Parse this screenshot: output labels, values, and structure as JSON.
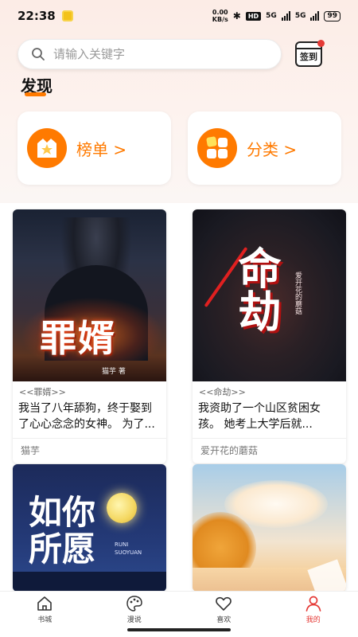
{
  "status_bar": {
    "time": "22:38",
    "net_speed_value": "0.00",
    "net_speed_unit": "KB/s",
    "hd": "HD",
    "sig1": "5G",
    "sig2": "5G",
    "battery": "99"
  },
  "header": {
    "search_placeholder": "请输入关键字",
    "checkin_label": "签到"
  },
  "discover": {
    "title": "发现",
    "cards": [
      {
        "label": "榜单 >",
        "icon": "ranking-icon"
      },
      {
        "label": "分类 >",
        "icon": "category-icon"
      }
    ]
  },
  "books": [
    {
      "cover_title": "罪婿",
      "cover_author": "猫芋 著",
      "tag": "<<罪婿>>",
      "desc": "我当了八年舔狗，终于娶到了心心念念的女神。 为了...",
      "author": "猫芋"
    },
    {
      "cover_title": "命劫",
      "cover_author": "爱开花的蘑菇",
      "tag": "<<命劫>>",
      "desc": "我资助了一个山区贫困女孩。 她考上大学后就...",
      "author": "爱开花的蘑菇"
    },
    {
      "cover_title": "如你所愿",
      "cover_sub": "RUNI SUOYUAN",
      "tag": "",
      "desc": "",
      "author": ""
    },
    {
      "cover_title": "",
      "tag": "",
      "desc": "",
      "author": ""
    }
  ],
  "bottom_nav": [
    {
      "label": "书城",
      "icon": "home-icon"
    },
    {
      "label": "漫说",
      "icon": "palette-icon"
    },
    {
      "label": "喜欢",
      "icon": "heart-icon"
    },
    {
      "label": "我的",
      "icon": "user-icon"
    }
  ],
  "colors": {
    "accent": "#ff7a00",
    "active_nav": "#e53935"
  }
}
